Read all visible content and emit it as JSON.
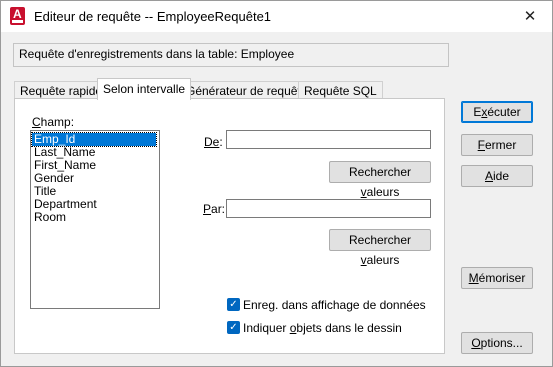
{
  "window": {
    "title": "Editeur de requête -- EmployeeRequête1",
    "close_glyph": "✕"
  },
  "info": {
    "text": "Requête d'enregistrements dans la table:  Employee"
  },
  "tabs": [
    {
      "label": "Requête rapide"
    },
    {
      "label": "Selon intervalle"
    },
    {
      "label": "Générateur de requête"
    },
    {
      "label": "Requête SQL"
    }
  ],
  "range": {
    "field_label_pre": "C",
    "field_label_rest": "hamp:",
    "fields": [
      "Emp_Id",
      "Last_Name",
      "First_Name",
      "Gender",
      "Title",
      "Department",
      "Room"
    ],
    "from_label_pre": "De",
    "from_label_rest": ":",
    "from_value": "",
    "to_label_pre": "P",
    "to_label_rest": "ar:",
    "to_value": "",
    "lookup1_pre": "Rechercher ",
    "lookup1_u": "v",
    "lookup1_post": "aleurs",
    "lookup2_pre": "Rechercher ",
    "lookup2_u": "v",
    "lookup2_post": "aleurs",
    "check1_pre": "Enre",
    "check1_u": "g",
    "check1_post": ". dans affichage de données",
    "check2_pre": "Indiquer ",
    "check2_u": "o",
    "check2_post": "bjets dans le dessin",
    "checked_glyph": "✓"
  },
  "buttons": {
    "execute_pre": "E",
    "execute_u": "x",
    "execute_post": "écuter",
    "close_pre": "",
    "close_u": "F",
    "close_post": "ermer",
    "help_pre": "",
    "help_u": "A",
    "help_post": "ide",
    "store_pre": "",
    "store_u": "M",
    "store_post": "émoriser",
    "options_pre": "",
    "options_u": "O",
    "options_post": "ptions..."
  }
}
